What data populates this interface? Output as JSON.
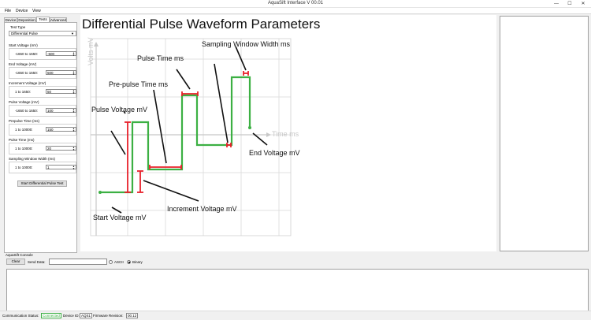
{
  "window": {
    "title": "AquaSift Interface V 00.01",
    "min_glyph": "—",
    "max_glyph": "☐",
    "close_glyph": "✕"
  },
  "menu": {
    "items": [
      "File",
      "Device",
      "View"
    ]
  },
  "tabs": [
    "Device",
    "Deposition",
    "Tests",
    "Advanced"
  ],
  "test_type": {
    "label": "Test Type",
    "value": "Differential Pulse"
  },
  "fields": [
    {
      "label": "Start Voltage (mV)",
      "range": "-1650 to 1650:",
      "value": "-500"
    },
    {
      "label": "End Voltage (mV)",
      "range": "-1650 to 1650:",
      "value": "500"
    },
    {
      "label": "Increment Voltage (mV)",
      "range": "1 to 1650:",
      "value": "50"
    },
    {
      "label": "Pulse Voltage (mV)",
      "range": "-1650 to 1650:",
      "value": "100"
    },
    {
      "label": "Prepulse Time (ms)",
      "range": "1 to 10000:",
      "value": "150"
    },
    {
      "label": "Pulse Time (ms)",
      "range": "1 to 10000:",
      "value": "20"
    },
    {
      "label": "Sampling Window Width (ms)",
      "range": "1 to 10000:",
      "value": "1"
    }
  ],
  "start_button": "Start Differential Pulse Test",
  "diagram": {
    "title": "Differential Pulse Waveform Parameters",
    "axis_y": "Volts mV",
    "axis_x": "Time ms",
    "annotations": {
      "sampling_window": "Sampling Window Width ms",
      "pulse_time": "Pulse Time ms",
      "prepulse_time": "Pre-pulse Time ms",
      "pulse_voltage": "Pulse Voltage mV",
      "end_voltage": "End Voltage mV",
      "increment_voltage": "Increment Voltage mV",
      "start_voltage": "Start Voltage mV"
    },
    "colors": {
      "waveform": "#3cb043",
      "marker": "#e8202a",
      "grid": "#d9d9d9",
      "axis": "#c8c8c8"
    }
  },
  "console": {
    "label": "AquaSift Console",
    "clear": "Clear",
    "send_label": "Send Data:",
    "send_value": "",
    "ascii": "ASCII",
    "binary": "Binary"
  },
  "status": {
    "comm_label": "Communication Status:",
    "comm_value": "Connected",
    "comm_color": "#3cb043",
    "device_label": "Device ID:",
    "device_value": "AQS1",
    "firmware_label": "Firmware Revision:",
    "firmware_value": "00.12"
  }
}
